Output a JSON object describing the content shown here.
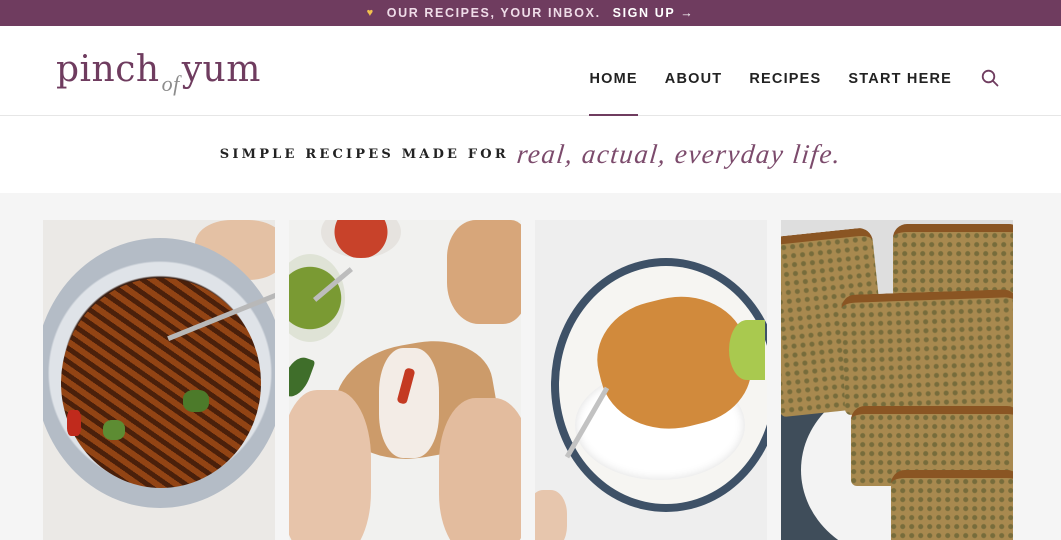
{
  "promo_bar": {
    "icon": "heart-icon",
    "text": "OUR RECIPES, YOUR INBOX.",
    "cta": "SIGN UP",
    "cta_arrow": "→"
  },
  "header": {
    "logo": {
      "part1": "pinch",
      "part2": "of",
      "part3": "yum"
    },
    "nav": [
      {
        "label": "HOME",
        "active": true
      },
      {
        "label": "ABOUT"
      },
      {
        "label": "RECIPES"
      },
      {
        "label": "START HERE"
      }
    ],
    "search_icon": "search-icon"
  },
  "tagline": {
    "plain": "SIMPLE RECIPES MADE FOR",
    "script": "real, actual, everyday life."
  },
  "recipe_cards": [
    {
      "image": "noodle-bowl"
    },
    {
      "image": "grilled-sandwich"
    },
    {
      "image": "chicken-rice-bowl"
    },
    {
      "image": "zucchini-bread"
    }
  ],
  "colors": {
    "brand": "#6f3c5f",
    "accent": "#f2c14e"
  }
}
